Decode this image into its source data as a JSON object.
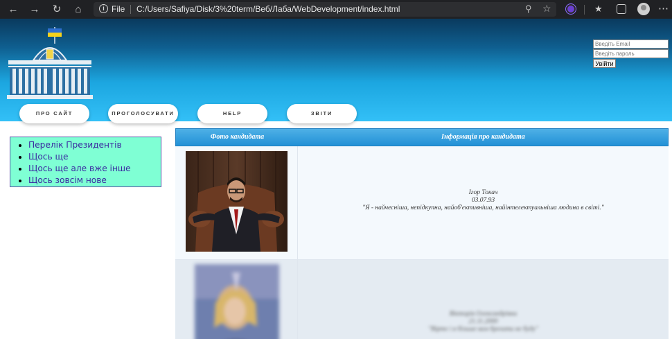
{
  "browser": {
    "file_label": "File",
    "url": "C:/Users/Safiya/Disk/3%20term/Веб/Лаба/WebDevelopment/index.html"
  },
  "login": {
    "email_placeholder": "Введіть Email",
    "password_placeholder": "Введіть пароль",
    "submit_label": "Увійти"
  },
  "menu": [
    {
      "label": "ПРО САЙТ"
    },
    {
      "label": "ПРОГОЛОСУВАТИ"
    },
    {
      "label": "HELP"
    },
    {
      "label": "ЗВІТИ"
    }
  ],
  "sidebar": {
    "items": [
      {
        "label": "Перелік Президентів"
      },
      {
        "label": "Щось ще"
      },
      {
        "label": "Щось ще але вже інше"
      },
      {
        "label": "Щось зовсім нове"
      }
    ]
  },
  "table": {
    "headers": {
      "photo": "Фото кандидата",
      "info": "Інформація про кандидата"
    },
    "rows": [
      {
        "name": "Ігор Токач",
        "date": "03.07.93",
        "quote": "\"Я - найчесніша, непідкупна, найоб'єктивніша, найінтелектуальніша людина в світі.\""
      },
      {
        "name": "Вікторія Олександрівна",
        "date": "21.11.2000",
        "quote": "\"Вірте і я більше вам брехати не буду\""
      }
    ]
  },
  "colors": {
    "header_top": "#0a3a5e",
    "header_bottom": "#33c0f7",
    "sidebar_bg": "#7fffd4",
    "sidebar_text": "#3a2aa0",
    "table_header": "#2291d6"
  }
}
